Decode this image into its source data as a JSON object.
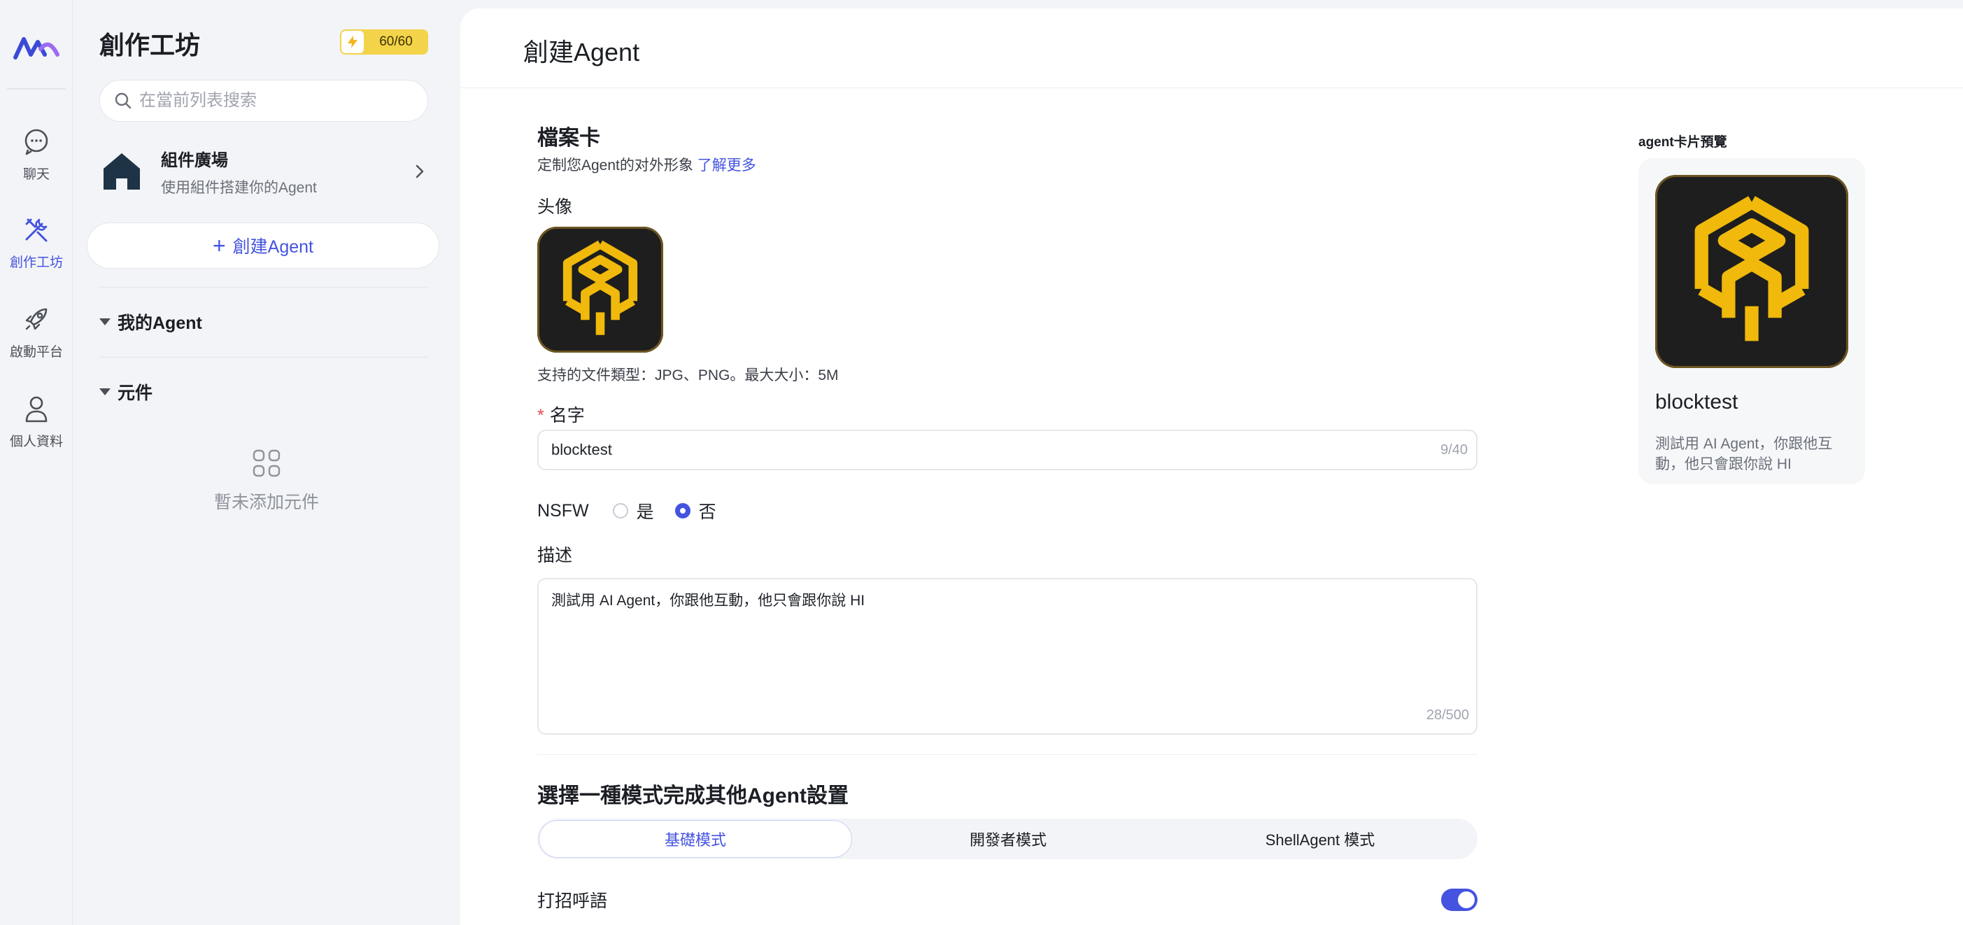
{
  "rail": {
    "items": [
      {
        "label": "聊天",
        "icon": "chat-icon"
      },
      {
        "label": "創作工坊",
        "icon": "tools-icon"
      },
      {
        "label": "啟動平台",
        "icon": "rocket-icon"
      },
      {
        "label": "個人資料",
        "icon": "user-icon"
      }
    ],
    "active_index": 1
  },
  "sidebar": {
    "title": "創作工坊",
    "credit": "60/60",
    "search_placeholder": "在當前列表搜索",
    "plaza": {
      "title": "組件廣場",
      "subtitle": "使用組件搭建你的Agent"
    },
    "create_button": "創建Agent",
    "sections": [
      {
        "label": "我的Agent"
      },
      {
        "label": "元件"
      }
    ],
    "empty_text": "暫未添加元件"
  },
  "main": {
    "page_title": "創建Agent",
    "profile_card": {
      "title": "檔案卡",
      "subtitle": "定制您Agent的对外形象",
      "learn_more": "了解更多"
    },
    "avatar_label": "头像",
    "file_hint": "支持的文件類型：JPG、PNG。最大大小：5M",
    "name_label": "名字",
    "name_value": "blocktest",
    "name_counter": "9/40",
    "nsfw": {
      "label": "NSFW",
      "options": [
        "是",
        "否"
      ],
      "selected": "否"
    },
    "description_label": "描述",
    "description_value": "測試用 AI Agent，你跟他互動，他只會跟你說 HI",
    "description_counter": "28/500",
    "mode_title": "選擇一種模式完成其他Agent設置",
    "mode_tabs": [
      "基礎模式",
      "開發者模式",
      "ShellAgent 模式"
    ],
    "active_mode": "基礎模式",
    "greeting_label": "打招呼語",
    "greeting_enabled": true
  },
  "preview": {
    "label": "agent卡片預覽",
    "name": "blocktest",
    "description": "測試用 AI Agent，你跟他互動，他只會跟你說 HI"
  },
  "colors": {
    "accent": "#4453e0",
    "credit_badge": "#f3d34a",
    "avatar_bg": "#1e1e1e",
    "avatar_gold": "#f0b90b"
  }
}
